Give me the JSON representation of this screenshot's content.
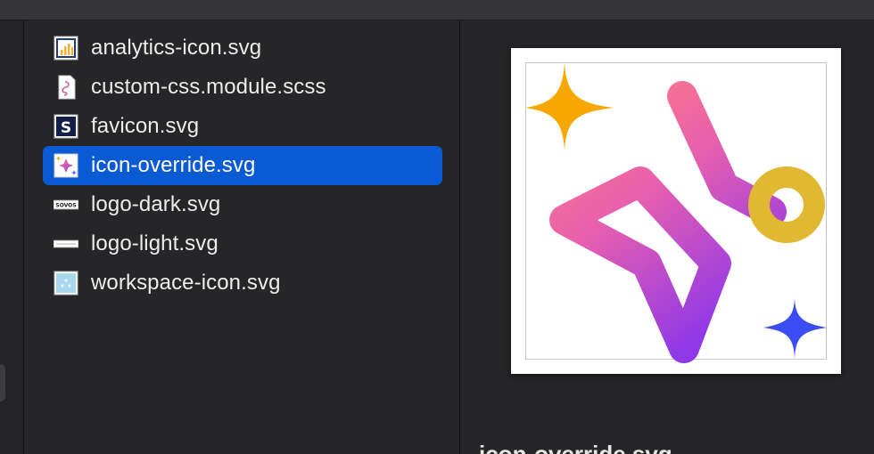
{
  "files": [
    {
      "name": "analytics-icon.svg",
      "icon": "analytics-chart-icon",
      "selected": false
    },
    {
      "name": "custom-css.module.scss",
      "icon": "scss-file-icon",
      "selected": false
    },
    {
      "name": "favicon.svg",
      "icon": "favicon-s-icon",
      "selected": false
    },
    {
      "name": "icon-override.svg",
      "icon": "sparkle-icon",
      "selected": true
    },
    {
      "name": "logo-dark.svg",
      "icon": "logo-dark-icon",
      "selected": false
    },
    {
      "name": "logo-light.svg",
      "icon": "logo-light-icon",
      "selected": false
    },
    {
      "name": "workspace-icon.svg",
      "icon": "workspace-icon",
      "selected": false
    }
  ],
  "logo_dark_text": "SOVOS",
  "favicon_letter": "S",
  "preview": {
    "caption": "icon-override.svg",
    "colors": {
      "sparkle_gradient_start": "#ff7f7f",
      "sparkle_gradient_end": "#8f38e8",
      "small_sparkle_orange": "#f7a700",
      "small_sparkle_blue": "#3a4cf2",
      "ring": "#e0b832"
    }
  },
  "colors": {
    "selection": "#0a5bd3",
    "background": "#262629"
  }
}
